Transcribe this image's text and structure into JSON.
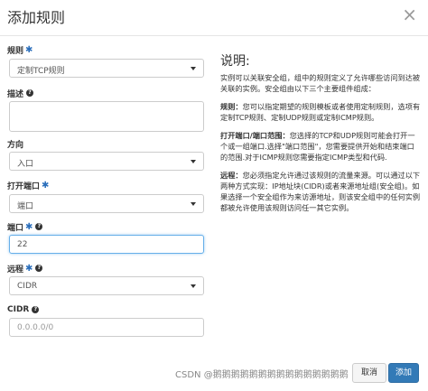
{
  "modal": {
    "title": "添加规则",
    "close": "×"
  },
  "form": {
    "rule": {
      "label": "规则",
      "value": "定制TCP规则"
    },
    "description": {
      "label": "描述"
    },
    "direction": {
      "label": "方向",
      "value": "入口"
    },
    "open_port": {
      "label": "打开端口",
      "value": "端口"
    },
    "port": {
      "label": "端口",
      "value": "22"
    },
    "remote": {
      "label": "远程",
      "value": "CIDR"
    },
    "cidr": {
      "label": "CIDR",
      "placeholder": "0.0.0.0/0"
    }
  },
  "help": {
    "title": "说明:",
    "intro": "实例可以关联安全组，组中的规则定义了允许哪些访问到达被关联的实例。安全组由以下三个主要组件组成：",
    "rule_term": "规则：",
    "rule_text": "您可以指定期望的规则模板或者使用定制规则，选项有定制TCP规则、定制UDP规则或定制ICMP规则。",
    "port_term": "打开端口/端口范围：",
    "port_text": "您选择的TCP和UDP规则可能会打开一个或一组端口.选择\"端口范围\"，您需要提供开始和结束端口的范围.对于ICMP规则您需要指定ICMP类型和代码.",
    "remote_term": "远程：",
    "remote_text": "您必须指定允许通过该规则的流量来源。可以通过以下两种方式实现：IP地址块(CIDR)或者来源地址组(安全组)。如果选择一个安全组作为来访源地址，则该安全组中的任何实例都被允许使用该规则访问任一其它实例。"
  },
  "footer": {
    "watermark": "CSDN @鹅鹅鹅鹅鹅鹅鹅鹅鹅鹅鹅鹅鹅鹅鹅",
    "cancel": "取消",
    "add": "添加"
  }
}
